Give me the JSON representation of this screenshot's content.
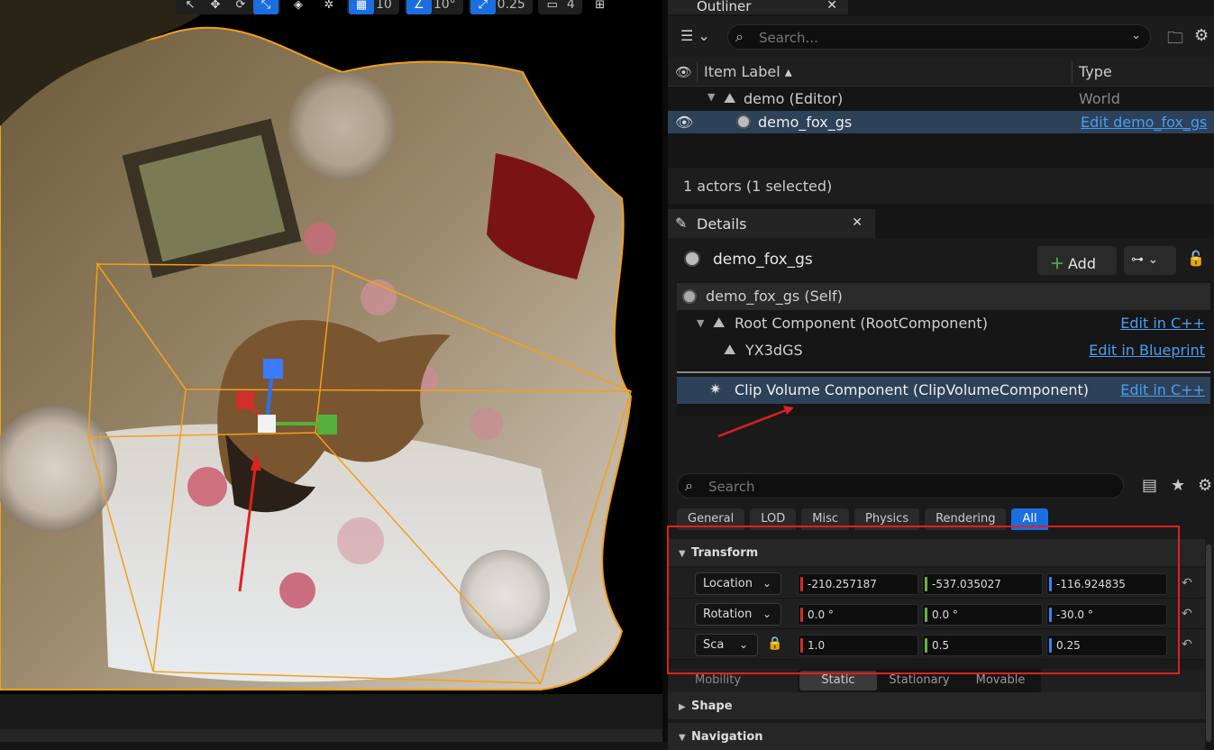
{
  "viewport": {
    "toolbar": {
      "grid_snap": "10",
      "angle_snap": "10°",
      "scale_snap": "0.25",
      "camera_speed": "4"
    }
  },
  "outliner": {
    "tab_label": "Outliner",
    "search_placeholder": "Search...",
    "columns": {
      "item_label": "Item Label",
      "type": "Type"
    },
    "rows": [
      {
        "label": "demo (Editor)",
        "type": "World"
      },
      {
        "label": "demo_fox_gs",
        "type": "Edit demo_fox_gs"
      }
    ],
    "status": "1 actors (1 selected)"
  },
  "details": {
    "tab_label": "Details",
    "actor_name": "demo_fox_gs",
    "add_label": "Add",
    "components": [
      {
        "label": "demo_fox_gs (Self)",
        "edit": ""
      },
      {
        "label": "Root Component (RootComponent)",
        "edit": "Edit in C++"
      },
      {
        "label": "YX3dGS",
        "edit": "Edit in Blueprint"
      },
      {
        "label": "Clip Volume Component (ClipVolumeComponent)",
        "edit": "Edit in C++"
      }
    ],
    "search_placeholder": "Search",
    "filter_tabs": [
      "General",
      "LOD",
      "Misc",
      "Physics",
      "Rendering",
      "All"
    ],
    "sections": {
      "transform": "Transform",
      "shape": "Shape",
      "navigation": "Navigation"
    },
    "transform": {
      "location": {
        "label": "Location",
        "x": "-210.257187",
        "y": "-537.035027",
        "z": "-116.924835"
      },
      "rotation": {
        "label": "Rotation",
        "x": "0.0 °",
        "y": "0.0 °",
        "z": "-30.0 °"
      },
      "scale": {
        "label": "Sca",
        "x": "1.0",
        "y": "0.5",
        "z": "0.25"
      }
    },
    "mobility": {
      "label": "Mobility",
      "options": [
        "Static",
        "Stationary",
        "Movable"
      ],
      "selected": "Static"
    }
  },
  "colors": {
    "accent": "#1a6ee0",
    "selection": "#2d4159",
    "link": "#4a9df2",
    "axis_x": "#d0302a",
    "axis_y": "#6ab04c",
    "axis_z": "#3b82f6",
    "annotation": "#e02020",
    "outline": "#f2a01a"
  }
}
